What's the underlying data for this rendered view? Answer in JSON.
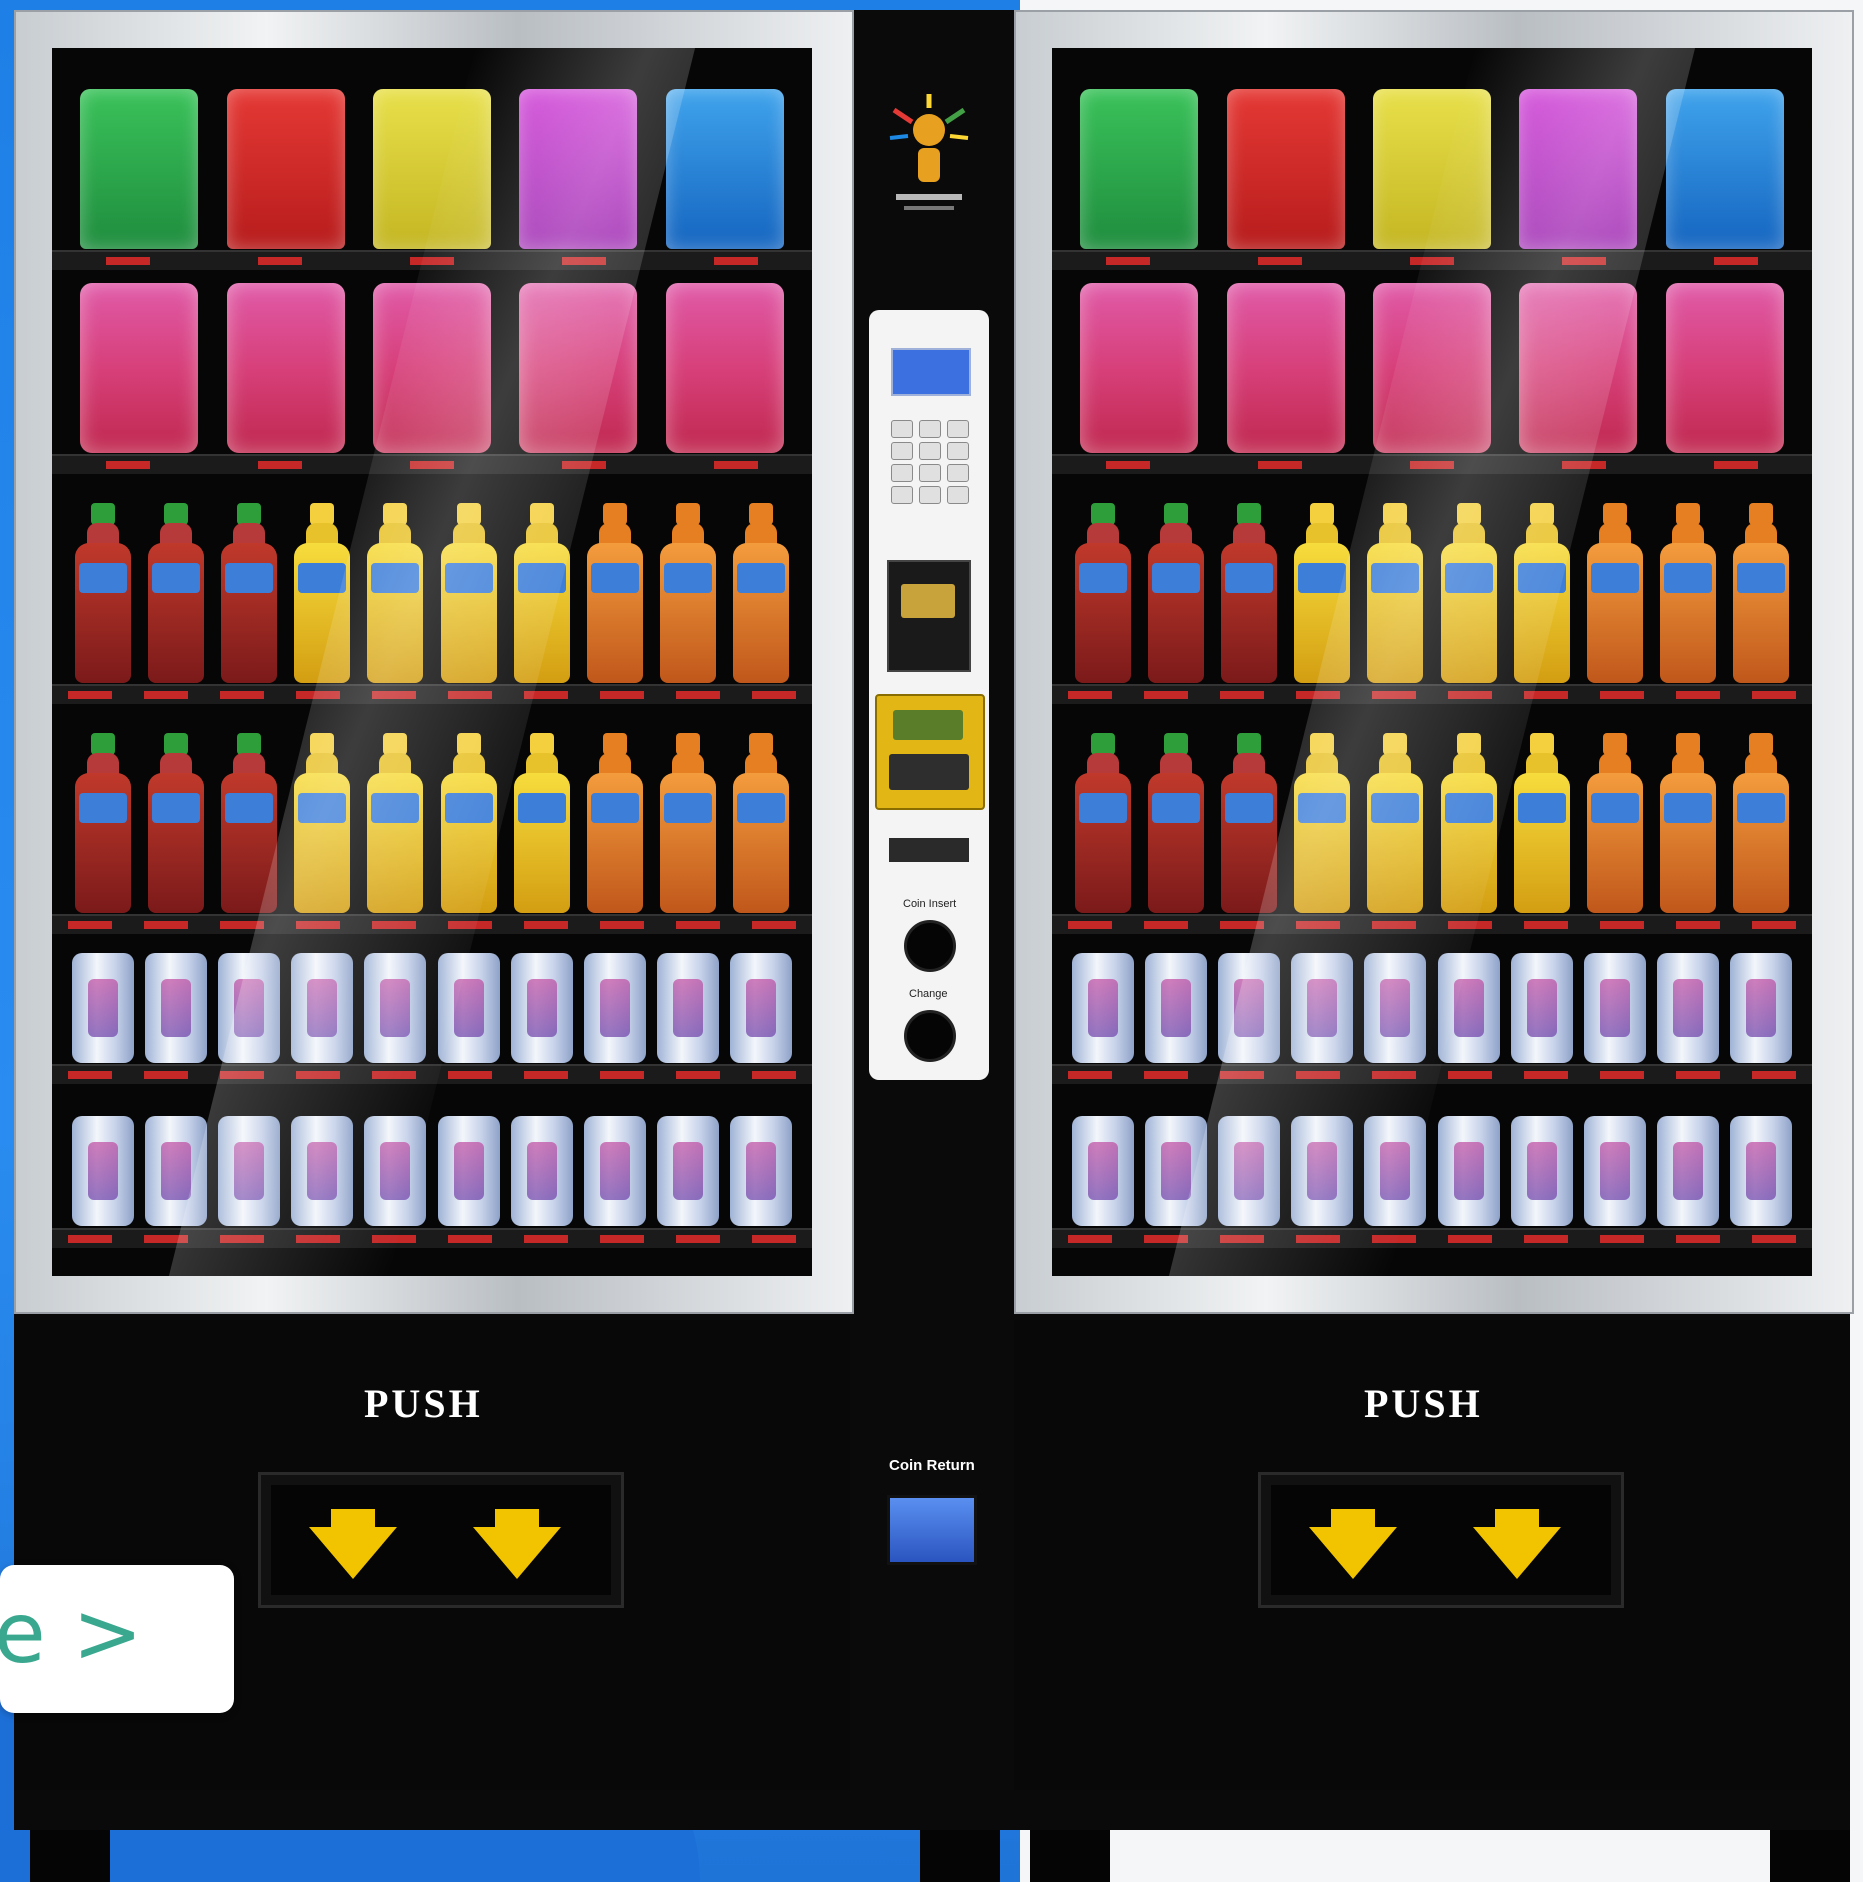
{
  "left_cabinet": {
    "push_label": "PUSH"
  },
  "right_cabinet": {
    "push_label": "PUSH"
  },
  "control_panel": {
    "coin_insert_label": "Coin Insert",
    "change_label": "Change",
    "coin_return_label": "Coin Return"
  },
  "popup": {
    "text": "e >"
  },
  "icons": [
    "arrow-down-icon",
    "arrow-down-icon",
    "brand-logo-icon"
  ]
}
